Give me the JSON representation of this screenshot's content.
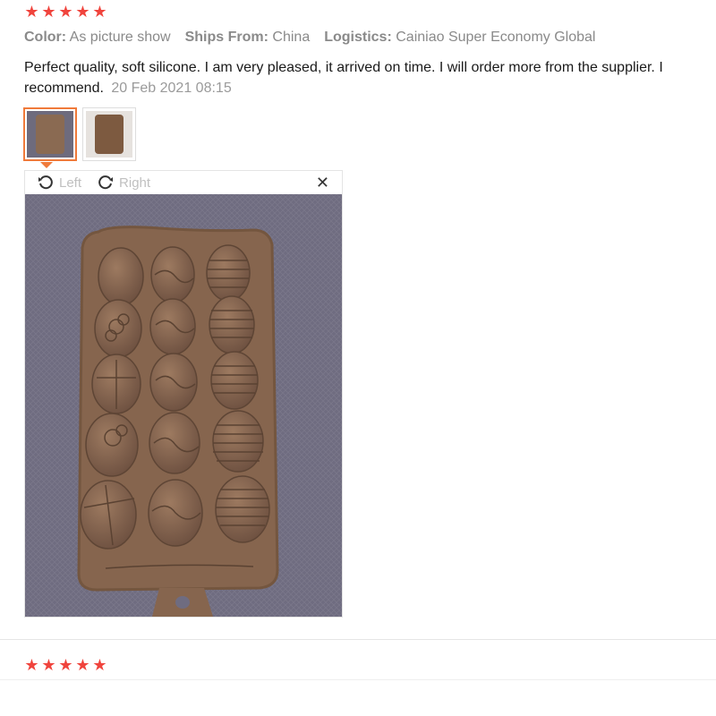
{
  "review1": {
    "rating": 5,
    "stars": [
      "★",
      "★",
      "★",
      "★",
      "★"
    ],
    "color_label": "Color:",
    "color_value": "As picture show",
    "ships_label": "Ships From:",
    "ships_value": "China",
    "logistics_label": "Logistics:",
    "logistics_value": "Cainiao Super Economy Global",
    "text": "Perfect quality, soft silicone. I am very pleased, it arrived on time. I will order more from the supplier. I recommend.",
    "date": "20 Feb 2021 08:15",
    "thumbnails": [
      "photo-1",
      "photo-2"
    ],
    "viewer": {
      "left_label": "Left",
      "right_label": "Right",
      "close_glyph": "✕",
      "photo_alt": "Chocolate silicone mold with 15 egg-shaped cavities"
    }
  },
  "review2": {
    "rating": 5,
    "stars": [
      "★",
      "★",
      "★",
      "★",
      "★"
    ]
  },
  "colors": {
    "star": "#f0443d",
    "accent": "#f07a3a",
    "mold": "#8a6a52",
    "fabric": "#6e6b7d"
  },
  "icons": [
    "rotate-left-icon",
    "rotate-right-icon",
    "close-icon",
    "star-icon"
  ]
}
